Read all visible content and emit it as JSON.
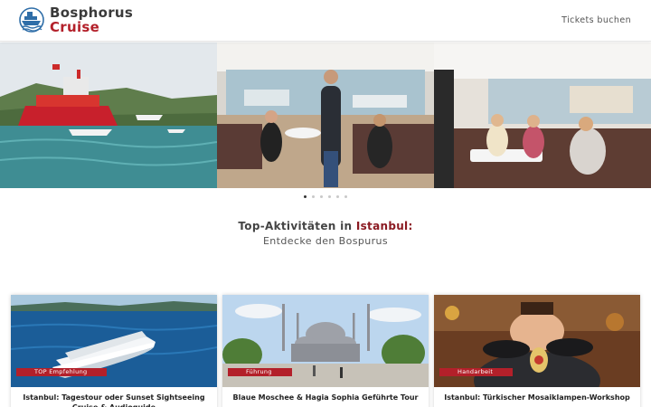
{
  "header": {
    "logo_line1": "Bosphorus",
    "logo_line2": "Cruise",
    "nav_link": "Tickets buchen"
  },
  "slider": {
    "dot_count": 6,
    "active_index": 0
  },
  "section": {
    "title_prefix": "Top-Aktivitäten in ",
    "title_accent": "Istanbul:",
    "subtitle": "Entdecke den Bospurus"
  },
  "cards": [
    {
      "badge": "TOP Empfehlung",
      "title": "Istanbul: Tagestour oder Sunset Sightseeing Cruise & Audioguide"
    },
    {
      "badge": "Führung",
      "title": "Blaue Moschee & Hagia Sophia Geführte Tour"
    },
    {
      "badge": "Handarbeit",
      "title": "Istanbul: Türkischer Mosaiklampen-Workshop"
    }
  ],
  "colors": {
    "brand_red": "#b3202a",
    "brand_dark": "#3a3a3a",
    "accent": "#8b1a22"
  }
}
